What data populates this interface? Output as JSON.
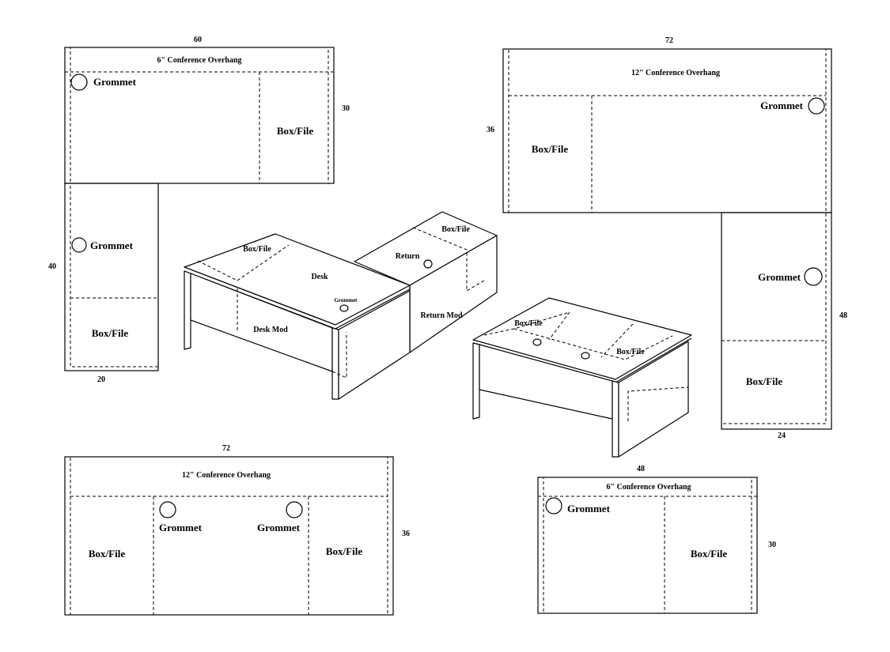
{
  "drawing_1": {
    "width_dim": "60",
    "depth_dim": "30",
    "return_length_dim": "40",
    "return_width_dim": "20",
    "overhang_label": "6\" Conference Overhang",
    "grommet_label_a": "Grommet",
    "boxfile_label_a": "Box/File",
    "grommet_label_b": "Grommet",
    "boxfile_label_b": "Box/File"
  },
  "drawing_2": {
    "width_dim": "72",
    "depth_dim": "36",
    "return_length_dim": "48",
    "return_width_dim": "24",
    "overhang_label": "12\" Conference Overhang",
    "grommet_label_a": "Grommet",
    "boxfile_label_a": "Box/File",
    "grommet_label_b": "Grommet",
    "boxfile_label_b": "Box/File"
  },
  "drawing_3": {
    "width_dim": "72",
    "depth_dim": "36",
    "overhang_label": "12\" Conference Overhang",
    "grommet_label_a": "Grommet",
    "grommet_label_b": "Grommet",
    "boxfile_label_a": "Box/File",
    "boxfile_label_b": "Box/File"
  },
  "drawing_4": {
    "width_dim": "48",
    "depth_dim": "30",
    "overhang_label": "6\" Conference Overhang",
    "grommet_label": "Grommet",
    "boxfile_label": "Box/File"
  },
  "iso_lshape": {
    "boxfile_desk_label": "Box/File",
    "desk_label": "Desk",
    "grommet_label": "Grommet",
    "desk_mod_label": "Desk Mod",
    "boxfile_return_label": "Box/File",
    "return_label": "Return",
    "return_mod_label": "Return Mod"
  },
  "iso_desk": {
    "boxfile_left_label": "Box/File",
    "boxfile_right_label": "Box/File"
  }
}
